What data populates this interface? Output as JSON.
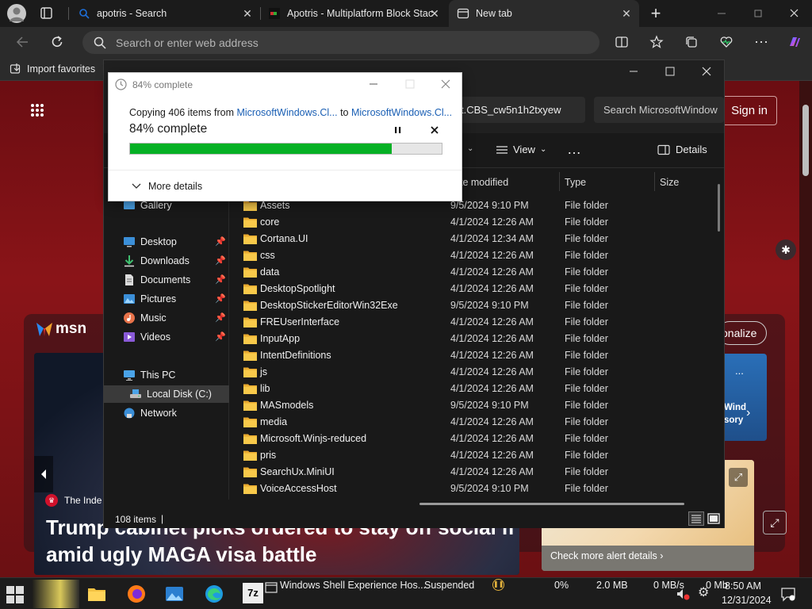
{
  "browser": {
    "tabs": [
      {
        "title": "apotris - Search",
        "active": false
      },
      {
        "title": "Apotris - Multiplatform Block Stac",
        "active": false
      },
      {
        "title": "New tab",
        "active": true
      }
    ],
    "omnibox_placeholder": "Search or enter web address",
    "favorites_bar": {
      "import_label": "Import favorites"
    }
  },
  "webpage": {
    "brand": "msn",
    "sign_in": "Sign in",
    "personalize": "onalize",
    "news_source": "The Inde",
    "headline_line1": "Trump cabinet picks ordered to stay off social media",
    "headline_line2": "amid ugly MAGA visa battle",
    "weather_link": "Check more alert details",
    "wind_text1": "Wind",
    "wind_text2": "sory",
    "ellipsis": "..."
  },
  "explorer": {
    "address_tail": "t.CBS_cw5n1h2txyew",
    "search_placeholder": "Search MicrosoftWindow",
    "view_label": "View",
    "more_label": "…",
    "details_label": "Details",
    "columns": {
      "date": "te modified",
      "type": "Type",
      "size": "Size"
    },
    "nav": {
      "gallery": "Gallery",
      "desktop": "Desktop",
      "downloads": "Downloads",
      "documents": "Documents",
      "pictures": "Pictures",
      "music": "Music",
      "videos": "Videos",
      "this_pc": "This PC",
      "local_disk": "Local Disk (C:)",
      "network": "Network"
    },
    "files": [
      {
        "name": "Assets",
        "date": "9/5/2024 9:10 PM",
        "type": "File folder"
      },
      {
        "name": "core",
        "date": "4/1/2024 12:26 AM",
        "type": "File folder"
      },
      {
        "name": "Cortana.UI",
        "date": "4/1/2024 12:34 AM",
        "type": "File folder"
      },
      {
        "name": "css",
        "date": "4/1/2024 12:26 AM",
        "type": "File folder"
      },
      {
        "name": "data",
        "date": "4/1/2024 12:26 AM",
        "type": "File folder"
      },
      {
        "name": "DesktopSpotlight",
        "date": "4/1/2024 12:26 AM",
        "type": "File folder"
      },
      {
        "name": "DesktopStickerEditorWin32Exe",
        "date": "9/5/2024 9:10 PM",
        "type": "File folder"
      },
      {
        "name": "FREUserInterface",
        "date": "4/1/2024 12:26 AM",
        "type": "File folder"
      },
      {
        "name": "InputApp",
        "date": "4/1/2024 12:26 AM",
        "type": "File folder"
      },
      {
        "name": "IntentDefinitions",
        "date": "4/1/2024 12:26 AM",
        "type": "File folder"
      },
      {
        "name": "js",
        "date": "4/1/2024 12:26 AM",
        "type": "File folder"
      },
      {
        "name": "lib",
        "date": "4/1/2024 12:26 AM",
        "type": "File folder"
      },
      {
        "name": "MASmodels",
        "date": "9/5/2024 9:10 PM",
        "type": "File folder"
      },
      {
        "name": "media",
        "date": "4/1/2024 12:26 AM",
        "type": "File folder"
      },
      {
        "name": "Microsoft.Winjs-reduced",
        "date": "4/1/2024 12:26 AM",
        "type": "File folder"
      },
      {
        "name": "pris",
        "date": "4/1/2024 12:26 AM",
        "type": "File folder"
      },
      {
        "name": "SearchUx.MiniUI",
        "date": "4/1/2024 12:26 AM",
        "type": "File folder"
      },
      {
        "name": "VoiceAccessHost",
        "date": "9/5/2024 9:10 PM",
        "type": "File folder"
      }
    ],
    "status_count": "108 items",
    "status_sep": "|"
  },
  "copy_dialog": {
    "title": "84% complete",
    "line_prefix": "Copying 406 items from ",
    "source": "MicrosoftWindows.Cl...",
    "to": " to ",
    "dest": "MicrosoftWindows.Cl...",
    "percent_label": "84% complete",
    "progress": 0.84,
    "more_details": "More details"
  },
  "taskbar": {
    "task_name": "Windows Shell Experience Hos...",
    "task_status": "Suspended",
    "cpu": "0%",
    "memory": "2.0 MB",
    "disk": "0 MB/s",
    "network": "0 Mb",
    "time": "8:50 AM",
    "date": "12/31/2024"
  },
  "colors": {
    "progress_fill": "#06b025",
    "link": "#1a5fb4",
    "page_red": "#8a1418",
    "chrome_dark": "#2b2b2b"
  }
}
